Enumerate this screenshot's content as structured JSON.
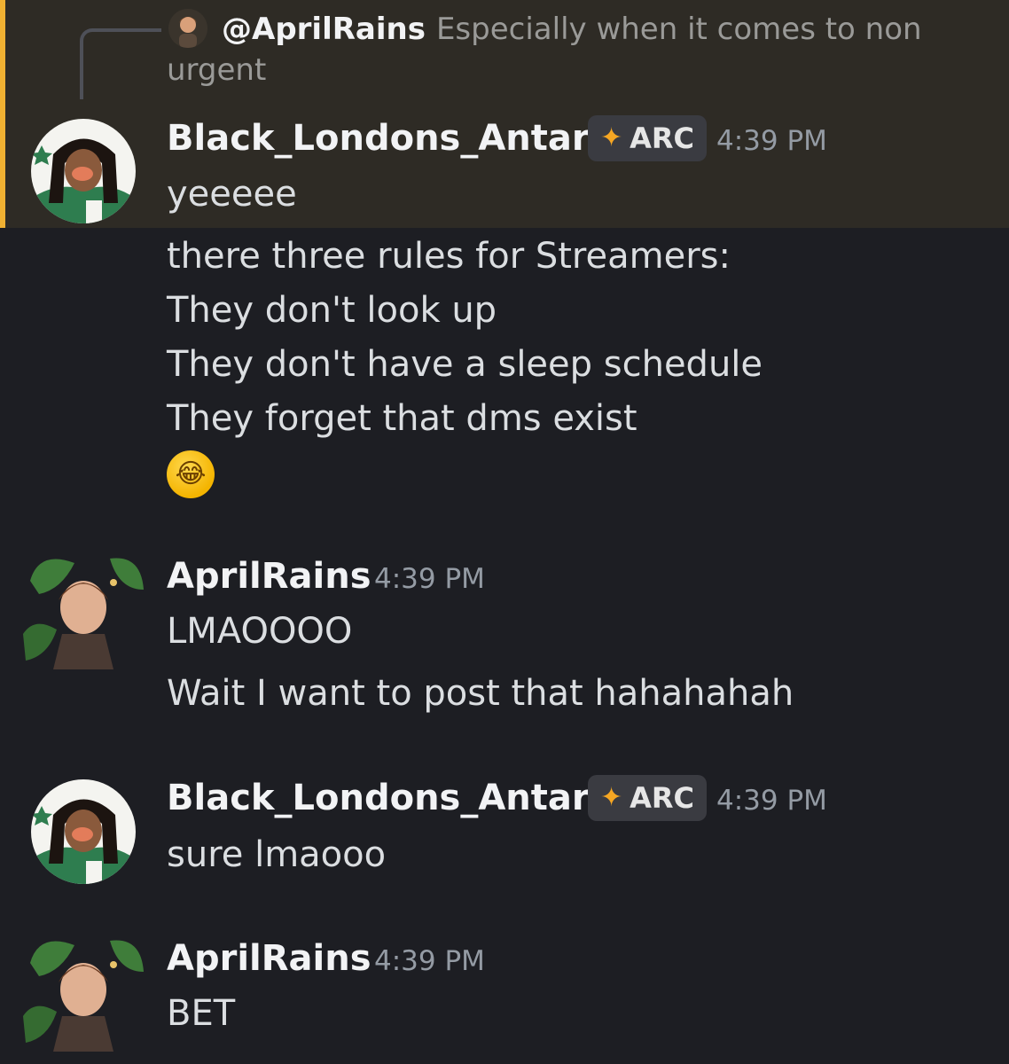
{
  "reply": {
    "username": "@AprilRains",
    "text": "Especially when it comes to non urgent"
  },
  "messages": [
    {
      "username": "Black_Londons_Antari",
      "tag": "ARC",
      "time": "4:39 PM",
      "lines": [
        "yeeeee",
        "there three rules for Streamers:",
        "They don't look up",
        "They don't have a sleep schedule",
        "They forget that dms exist"
      ],
      "emoji": "rolling-on-floor-laughing"
    },
    {
      "username": "AprilRains",
      "time": "4:39 PM",
      "lines": [
        "LMAOOOO",
        "Wait I want to post that hahahahah"
      ]
    },
    {
      "username": "Black_Londons_Antari",
      "tag": "ARC",
      "time": "4:39 PM",
      "lines": [
        "sure lmaooo"
      ]
    },
    {
      "username": "AprilRains",
      "time": "4:39 PM",
      "lines": [
        "BET"
      ]
    }
  ],
  "colors": {
    "background": "#1d1e23",
    "highlight": "#2e2b25",
    "highlight_border": "#f0b132",
    "tag_background": "#3a3b41",
    "timestamp": "#949ba4"
  }
}
